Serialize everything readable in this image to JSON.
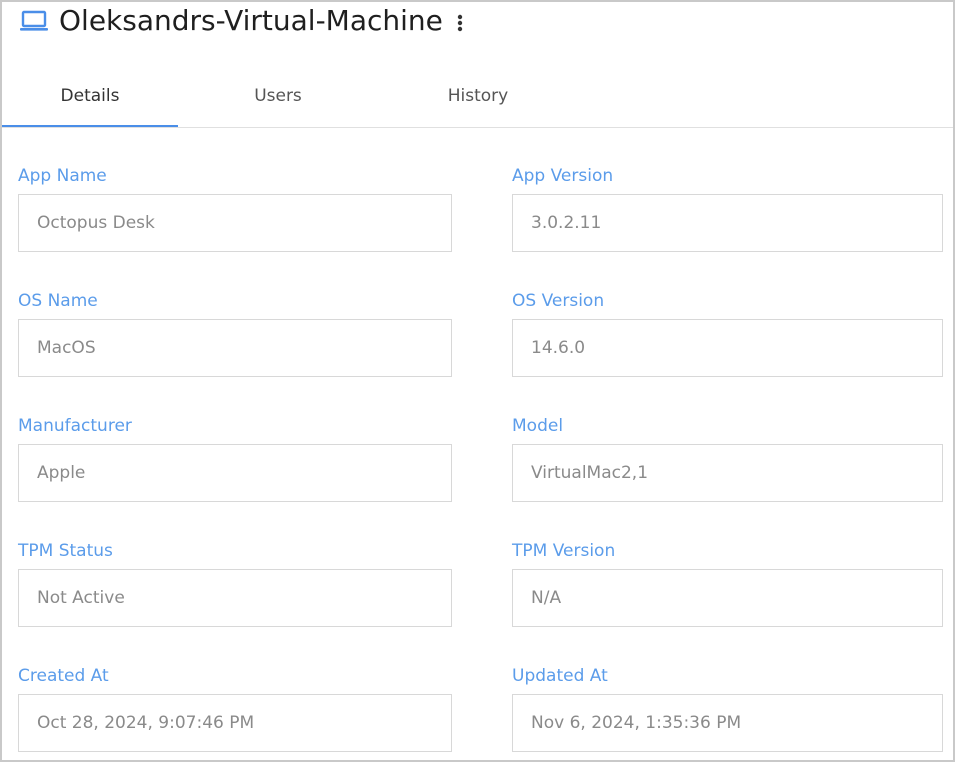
{
  "header": {
    "icon": "laptop-icon",
    "title": "Oleksandrs-Virtual-Machine",
    "more_icon": "more-vertical-icon"
  },
  "tabs": [
    {
      "label": "Details",
      "active": true
    },
    {
      "label": "Users",
      "active": false
    },
    {
      "label": "History",
      "active": false
    }
  ],
  "colors": {
    "accent": "#4a8ee8",
    "label": "#5b9cea",
    "value": "#8a8a8a",
    "title": "#1f1f1f"
  },
  "fields": {
    "app_name": {
      "label": "App Name",
      "value": "Octopus Desk"
    },
    "app_version": {
      "label": "App Version",
      "value": "3.0.2.11"
    },
    "os_name": {
      "label": "OS Name",
      "value": "MacOS"
    },
    "os_version": {
      "label": "OS Version",
      "value": "14.6.0"
    },
    "manufacturer": {
      "label": "Manufacturer",
      "value": "Apple"
    },
    "model": {
      "label": "Model",
      "value": "VirtualMac2,1"
    },
    "tpm_status": {
      "label": "TPM Status",
      "value": "Not Active"
    },
    "tpm_version": {
      "label": "TPM Version",
      "value": "N/A"
    },
    "created_at": {
      "label": "Created At",
      "value": "Oct 28, 2024, 9:07:46 PM"
    },
    "updated_at": {
      "label": "Updated At",
      "value": "Nov 6, 2024, 1:35:36 PM"
    }
  }
}
